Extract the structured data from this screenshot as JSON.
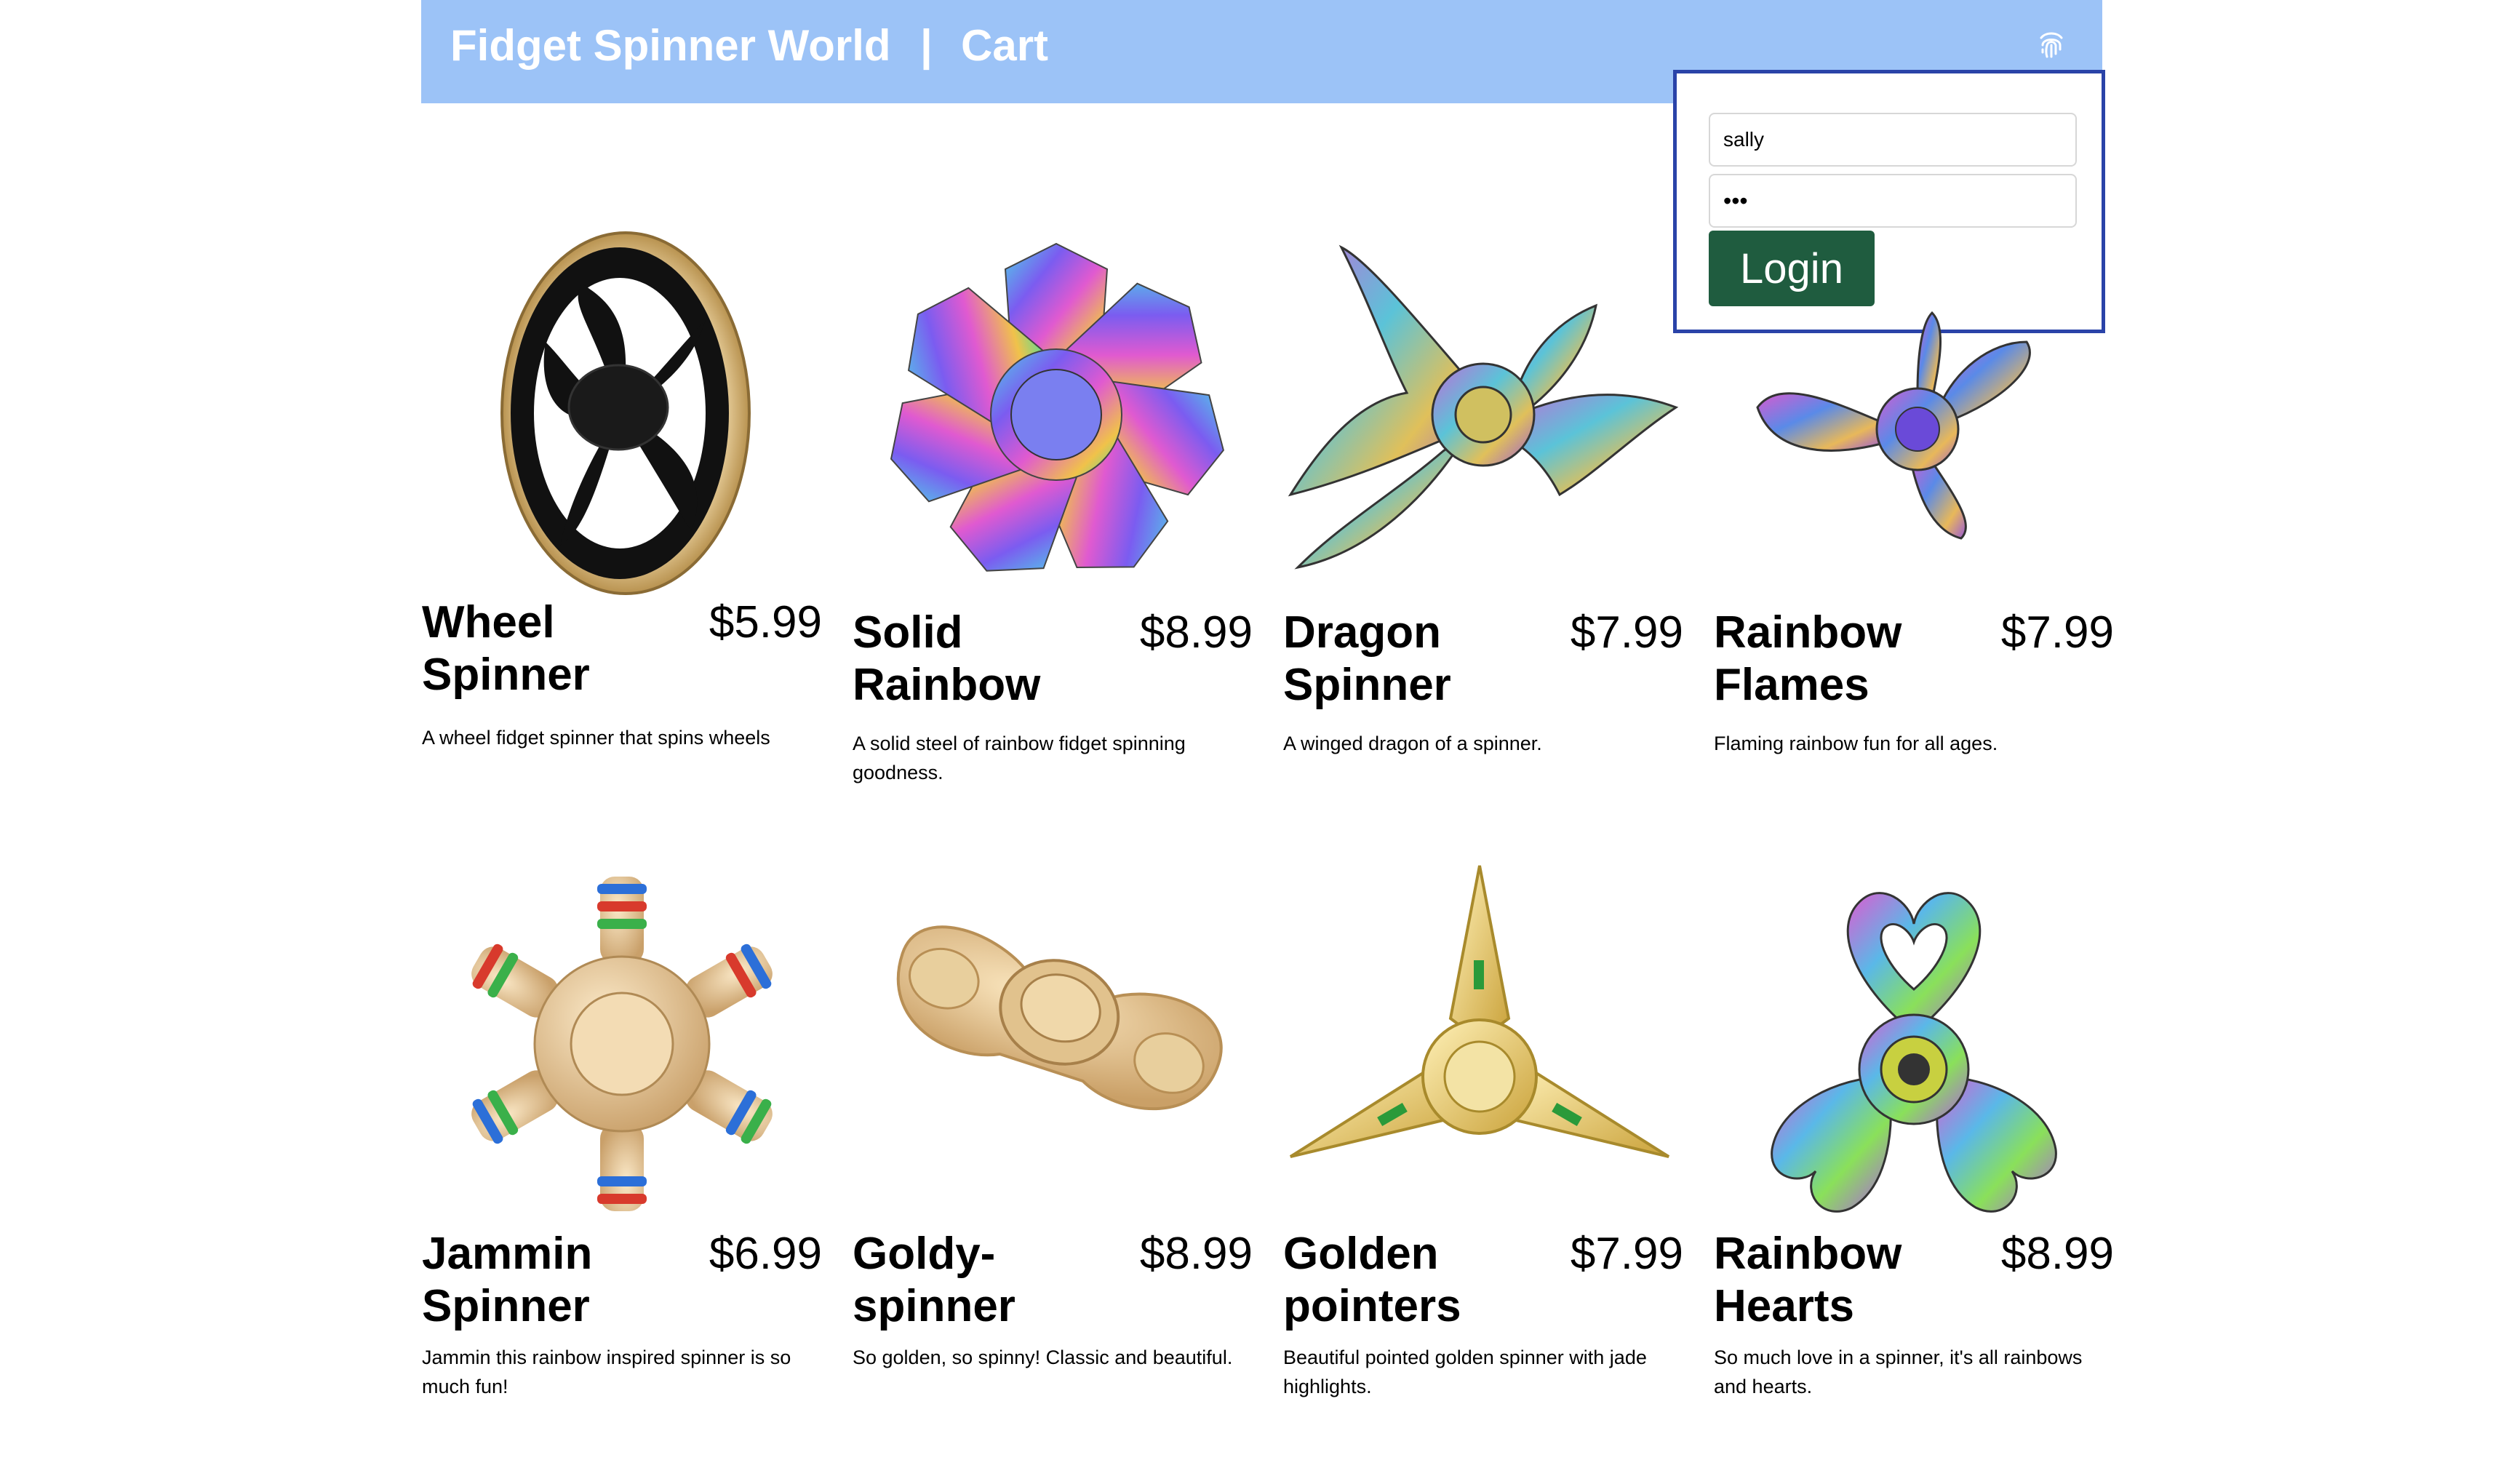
{
  "header": {
    "brand": "Fidget Spinner World",
    "separator": "|",
    "cart_label": "Cart",
    "background": "#9cc3f7"
  },
  "login": {
    "username_value": "sally",
    "password_value": "•••",
    "button_label": "Login",
    "border_color": "#2a43a8",
    "button_color": "#1f5c3f"
  },
  "products": [
    {
      "name": "Wheel Spinner",
      "price": "$5.99",
      "description": "A wheel fidget spinner that spins wheels",
      "icon": "wheel-spinner-image"
    },
    {
      "name": "Solid Rainbow",
      "price": "$8.99",
      "description": "A solid steel of rainbow fidget spinning goodness.",
      "icon": "rainbow-spinner-image"
    },
    {
      "name": "Dragon Spinner",
      "price": "$7.99",
      "description": "A winged dragon of a spinner.",
      "icon": "dragon-spinner-image"
    },
    {
      "name": "Rainbow Flames",
      "price": "$7.99",
      "description": "Flaming rainbow fun for all ages.",
      "icon": "flames-spinner-image"
    },
    {
      "name": "Jammin Spinner",
      "price": "$6.99",
      "description": "Jammin this rainbow inspired spinner is so much fun!",
      "icon": "jammin-spinner-image"
    },
    {
      "name": "Goldy-spinner",
      "price": "$8.99",
      "description": "So golden, so spinny! Classic and beautiful.",
      "icon": "gold-spinner-image"
    },
    {
      "name": "Golden pointers",
      "price": "$7.99",
      "description": "Beautiful pointed golden spinner with jade highlights.",
      "icon": "golden-pointers-image"
    },
    {
      "name": "Rainbow Hearts",
      "price": "$8.99",
      "description": "So much love in a spinner, it's all rainbows and hearts.",
      "icon": "hearts-spinner-image"
    }
  ]
}
